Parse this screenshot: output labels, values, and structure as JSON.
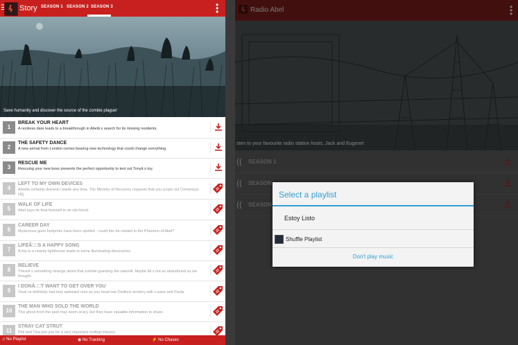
{
  "colors": {
    "brand_red": "#c8201e",
    "accent_blue": "#2e9fd1"
  },
  "left": {
    "menu_icon": "☰",
    "app_title": "Story",
    "tabs": [
      {
        "label": "SEASON 1",
        "active": false
      },
      {
        "label": "SEASON 2",
        "active": false
      },
      {
        "label": "SEASON 3",
        "active": true
      }
    ],
    "overflow_icon": "⋮",
    "hero_caption": "Save humanity and discover the source of the zombie plague!",
    "items": [
      {
        "num": "1",
        "title": "BREAK YOUR HEART",
        "desc": "A reckless dare leads to a breakthrough in Abelâ  s search for its missing residents.",
        "locked": false,
        "action": "download-icon"
      },
      {
        "num": "2",
        "title": "THE SAFETY DANCE",
        "desc": "A new arrival from London comes bearing new technology that could change everything.",
        "locked": false,
        "action": "download-icon"
      },
      {
        "num": "3",
        "title": "RESCUE ME",
        "desc": "Rescuing your new boss presents the perfect opportunity to test out Tonyâ  s toy.",
        "locked": false,
        "action": "download-icon"
      },
      {
        "num": "4",
        "title": "LEFT TO MY OWN DEVICES",
        "desc": "Amelia certainly doesnâ  t waste any time. The Ministry of Recovery requests that you scope out Comanoys HQ.",
        "locked": true,
        "action": "price-tag-icon"
      },
      {
        "num": "5",
        "title": "WALK OF LIFE",
        "desc": "Abel says its final farewell to an old friend.",
        "locked": true,
        "action": "price-tag-icon"
      },
      {
        "num": "6",
        "title": "CAREER DAY",
        "desc": "Mysterious giant footprints have been spotted - could this be related to the Phantom of Abel?",
        "locked": true,
        "action": "price-tag-icon"
      },
      {
        "num": "7",
        "title": "LIFEÂ□□S A HAPPY SONG",
        "desc": "A trip to a nearby lighthouse leads to some illuminating discoveries.",
        "locked": true,
        "action": "price-tag-icon"
      },
      {
        "num": "8",
        "title": "BELIEVE",
        "desc": "Thereâ  s something strange about that zombie guarding the sawmill. Maybe itâ  s not as abandoned as we thought.",
        "locked": true,
        "action": "price-tag-icon"
      },
      {
        "num": "9",
        "title": "I DONÂ□□T WANT TO GET OVER YOU",
        "desc": "Youâ  ve definitely had less awkward runs as you head into Dedlock territory with Louise and Paula.",
        "locked": true,
        "action": "price-tag-icon"
      },
      {
        "num": "10",
        "title": "THE MAN WHO SOLD THE WORLD",
        "desc": "This ghost from the past may seem scary, but they have valuable information to share.",
        "locked": true,
        "action": "price-tag-icon"
      },
      {
        "num": "11",
        "title": "STRAY CAT STRUT",
        "desc": "Phil and Tina join you for a very important rooftop mission.",
        "locked": true,
        "action": "price-tag-icon"
      }
    ],
    "bottom_bar": [
      {
        "icon": "music-note-icon",
        "label": "No Playlist"
      },
      {
        "icon": "tracking-icon",
        "label": "No Tracking"
      },
      {
        "icon": "runner-icon",
        "label": "No Chases"
      }
    ]
  },
  "right": {
    "app_title": "Radio Abel",
    "overflow_icon": "⋮",
    "hero_caption": "sten to your favourite radio station hosts, Jack and Eugene!",
    "seasons": [
      {
        "label": "SEASON 1"
      },
      {
        "label": "SEASON"
      },
      {
        "label": "SEASON"
      }
    ]
  },
  "dialog": {
    "title": "Select a playlist",
    "option1": "Estoy Listo",
    "option2": "Shuffle Playlist",
    "button": "Don't play music"
  }
}
